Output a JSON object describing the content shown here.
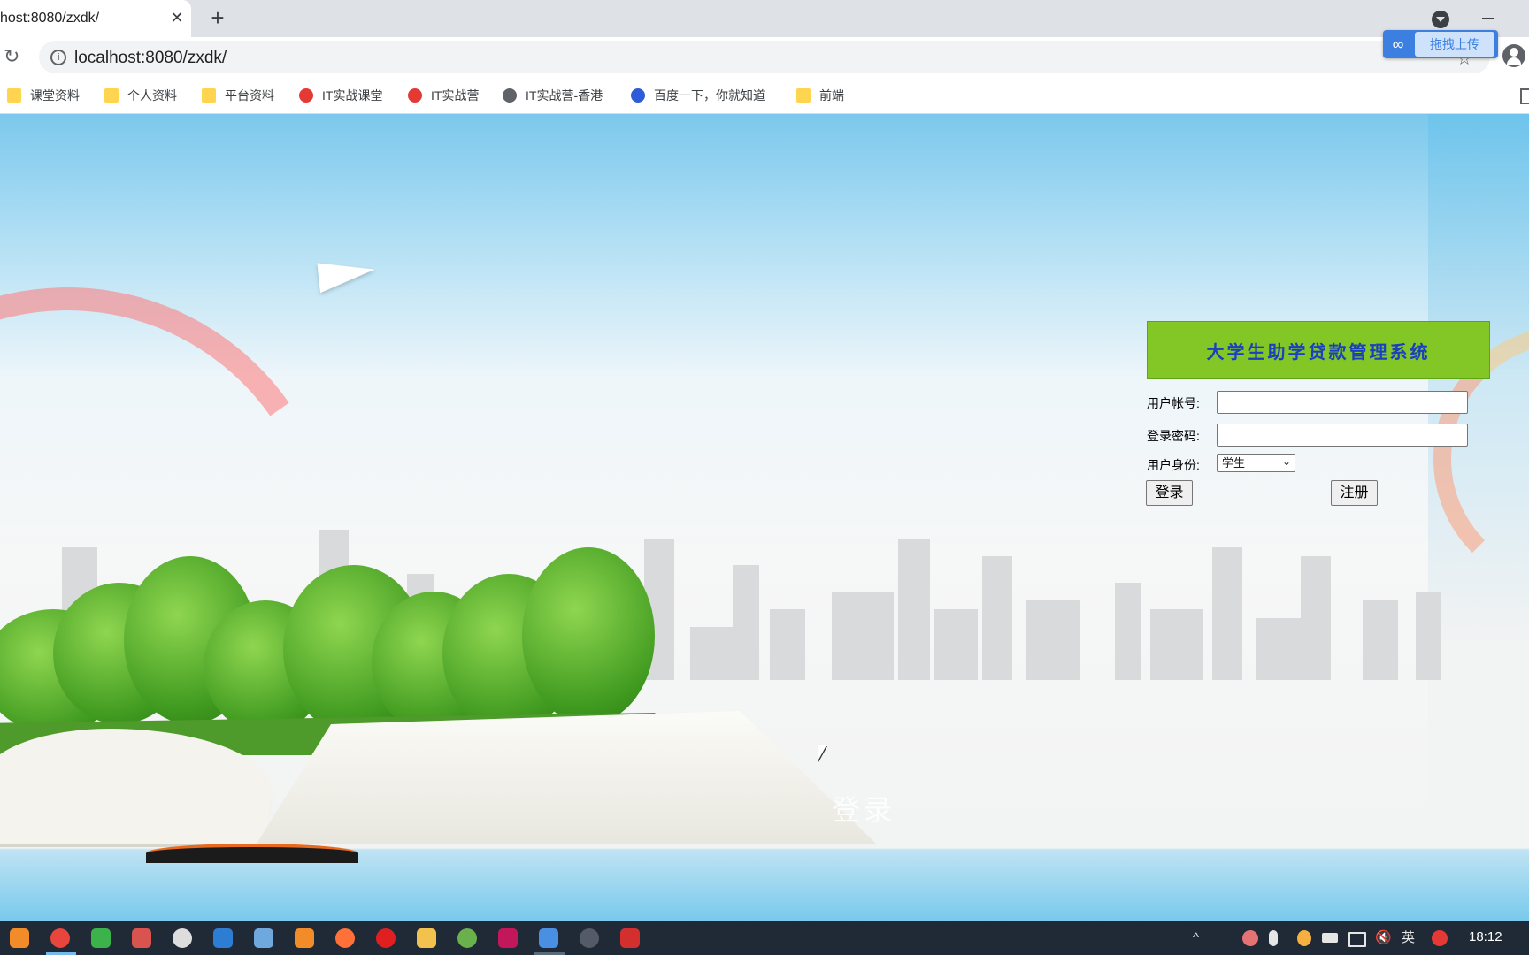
{
  "browser": {
    "tab_title": "host:8080/zxdk/",
    "close_glyph": "✕",
    "new_tab_glyph": "+",
    "reload_glyph": "↻",
    "info_glyph": "i",
    "url": "localhost:8080/zxdk/",
    "star_glyph": "☆",
    "upload_label": "拖拽上传",
    "upload_glyph": "∞"
  },
  "bookmarks": [
    {
      "label": "课堂资料",
      "icon": "folder-icon"
    },
    {
      "label": "个人资料",
      "icon": "folder-icon"
    },
    {
      "label": "平台资料",
      "icon": "folder-icon"
    },
    {
      "label": "IT实战课堂",
      "icon": "site-icon"
    },
    {
      "label": "IT实战营",
      "icon": "site-icon"
    },
    {
      "label": "IT实战营-香港",
      "icon": "globe-icon"
    },
    {
      "label": "百度一下，你就知道",
      "icon": "baidu-icon"
    },
    {
      "label": "前端",
      "icon": "folder-icon"
    }
  ],
  "login": {
    "system_title": "大学生助学贷款管理系统",
    "account_label": "用户帐号:",
    "account_value": "",
    "password_label": "登录密码:",
    "password_value": "",
    "role_label": "用户身份:",
    "role_selected": "学生",
    "login_button": "登录",
    "register_button": "注册",
    "background_text": "登录"
  },
  "taskbar": {
    "chevron_glyph": "^",
    "ime": "英",
    "time": "18:12"
  },
  "colors": {
    "title_bg": "#82c726",
    "title_text": "#1a3fbf",
    "taskbar": "#1f2a36"
  }
}
